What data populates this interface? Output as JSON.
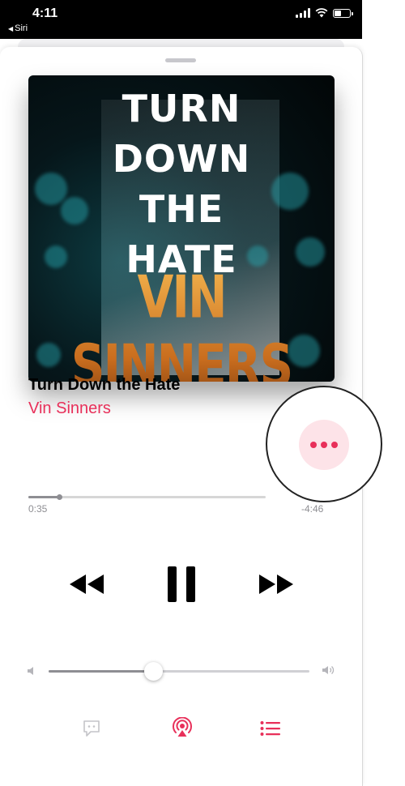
{
  "status_bar": {
    "time": "4:11",
    "back_label": "Siri",
    "back_glyph": "◀"
  },
  "now_playing": {
    "artwork": {
      "title_text": "TURN\nDOWN\nTHE\nHATE",
      "artist_text": "VIN SINNERS"
    },
    "song_title": "Turn Down the Hate",
    "artist": "Vin Sinners",
    "elapsed": "0:35",
    "remaining": "-4:46",
    "progress_fraction": 0.13,
    "volume_fraction": 0.4
  },
  "icons": {
    "more": "more-ellipsis-icon",
    "rewind": "rewind-icon",
    "pause": "pause-icon",
    "forward": "fast-forward-icon",
    "volume_low": "speaker-low-icon",
    "volume_high": "speaker-high-icon",
    "lyrics": "lyrics-bubble-icon",
    "airplay": "airplay-icon",
    "queue": "up-next-list-icon"
  },
  "colors": {
    "accent": "#e8305a",
    "accent_tint": "#fde3e8",
    "secondary": "#8e8e93",
    "primary_text": "#000000"
  }
}
